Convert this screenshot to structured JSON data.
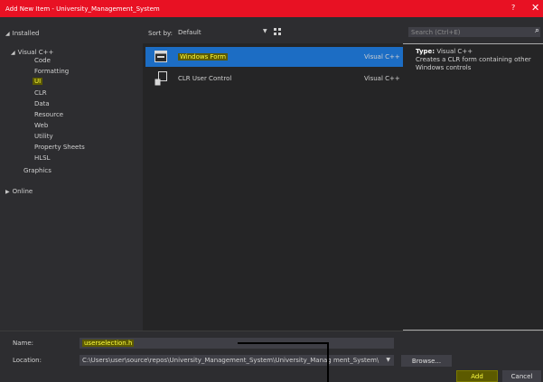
{
  "window": {
    "title": "Add New Item - University_Management_System",
    "help": "?",
    "close": "✕"
  },
  "tree": {
    "installed": "Installed",
    "visual_cpp": "Visual C++",
    "children": [
      "Code",
      "Formatting",
      "UI",
      "CLR",
      "Data",
      "Resource",
      "Web",
      "Utility",
      "Property Sheets",
      "HLSL"
    ],
    "graphics": "Graphics",
    "online": "Online"
  },
  "toolbar": {
    "sort_label": "Sort by:",
    "sort_value": "Default"
  },
  "search": {
    "placeholder": "Search (Ctrl+E)"
  },
  "templates": [
    {
      "name": "Windows Form",
      "lang": "Visual C++"
    },
    {
      "name": "CLR User Control",
      "lang": "Visual C++"
    }
  ],
  "description": {
    "type_label": "Type:",
    "type_value": "Visual C++",
    "text": "Creates a CLR form containing other Windows controls"
  },
  "form": {
    "name_label": "Name:",
    "name_value": "userselection.h",
    "location_label": "Location:",
    "location_value": "C:\\Users\\user\\source\\repos\\University_Management_System\\University_Manag ment_System\\"
  },
  "buttons": {
    "browse": "Browse...",
    "add": "Add",
    "cancel": "Cancel"
  },
  "colors": {
    "titlebar": "#e81123",
    "selection": "#1c6dc4",
    "highlight": "#ffff40"
  }
}
